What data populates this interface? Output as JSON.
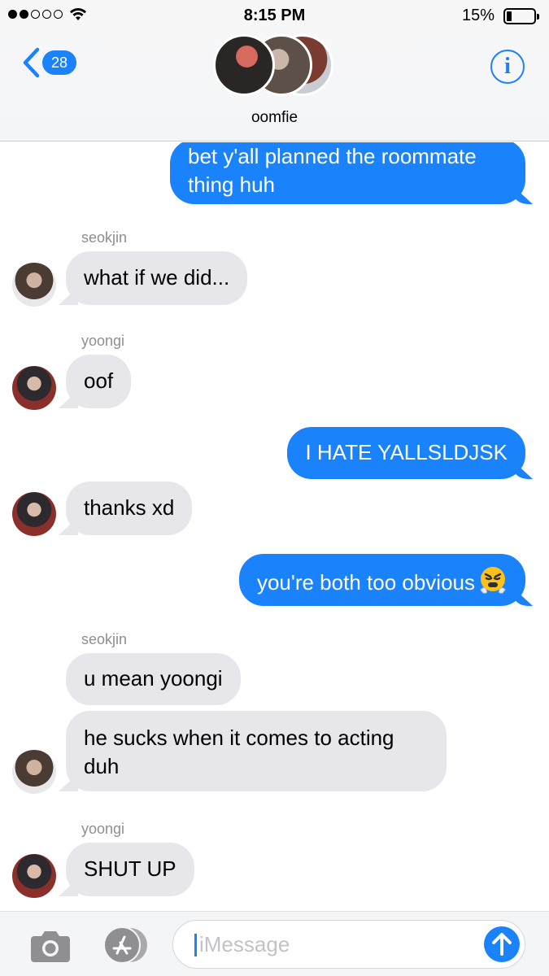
{
  "status_bar": {
    "time": "8:15 PM",
    "battery": "15%"
  },
  "header": {
    "back_count": "28",
    "group_name": "oomfie",
    "info_label": "i"
  },
  "messages": [
    {
      "direction": "outgoing",
      "text": "bet y'all planned the roommate thing huh"
    },
    {
      "direction": "incoming",
      "sender": "seokjin",
      "text": "what if we did..."
    },
    {
      "direction": "incoming",
      "sender": "yoongi",
      "text": "oof"
    },
    {
      "direction": "outgoing",
      "text": "I HATE YALLSLDJSK"
    },
    {
      "direction": "incoming",
      "sender": "yoongi",
      "text": "thanks xd"
    },
    {
      "direction": "outgoing",
      "text": "you're both too obvious",
      "emoji": "steam-from-nose-emoji"
    },
    {
      "direction": "incoming",
      "sender": "seokjin",
      "text": "u mean yoongi"
    },
    {
      "direction": "incoming",
      "sender": "seokjin",
      "text": "he sucks when it comes to acting duh"
    },
    {
      "direction": "incoming",
      "sender": "yoongi",
      "text": "SHUT UP"
    }
  ],
  "input": {
    "placeholder": "iMessage"
  },
  "colors": {
    "accent": "#1a82fb",
    "incoming_bubble": "#e6e6eb",
    "sender_label": "#8e8e93"
  }
}
